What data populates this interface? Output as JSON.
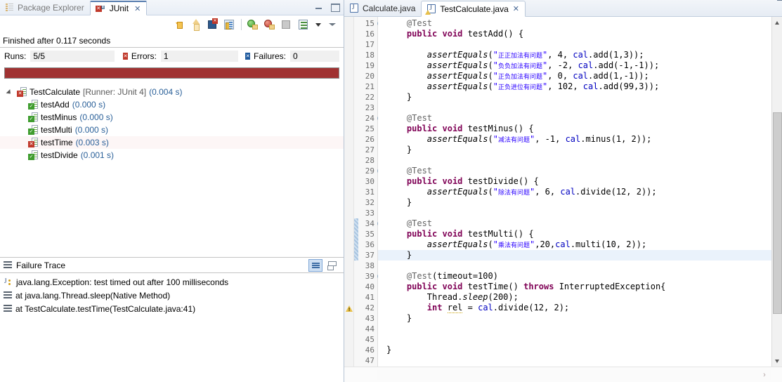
{
  "junit_view": {
    "tabs": [
      {
        "label": "Package Explorer",
        "icon": "package-explorer-icon",
        "active": false
      },
      {
        "label": "JUnit",
        "icon": "junit-icon",
        "active": true,
        "close": "✕"
      }
    ],
    "window_controls": {
      "minimize": "minimize-icon",
      "maximize": "maximize-icon"
    },
    "toolbar": [
      {
        "name": "next-failed-test-button",
        "icon": "arrow-down-icon",
        "tooltip": "Next Failed Test"
      },
      {
        "name": "previous-failed-test-button",
        "icon": "arrow-up-icon",
        "tooltip": "Previous Failed Test"
      },
      {
        "name": "show-failures-only-button",
        "icon": "failures-only-icon",
        "tooltip": "Show Failures Only"
      },
      {
        "name": "scroll-lock-button",
        "icon": "lock-icon",
        "tooltip": "Scroll Lock"
      },
      {
        "name": "rerun-test-button",
        "icon": "rerun-green-icon",
        "tooltip": "Rerun Test"
      },
      {
        "name": "rerun-failed-button",
        "icon": "rerun-failed-icon",
        "tooltip": "Rerun Test - Failures First"
      },
      {
        "name": "stop-button",
        "icon": "stop-icon",
        "tooltip": "Stop JUnit Test Run"
      },
      {
        "name": "test-run-history-button",
        "icon": "history-list-icon",
        "tooltip": "Test Run History"
      },
      {
        "name": "view-menu-button",
        "icon": "chevron-down-icon",
        "tooltip": "View Menu"
      },
      {
        "name": "minimize-view-button",
        "icon": "collapse-chevron-icon",
        "tooltip": "Minimize"
      }
    ],
    "status_text": "Finished after 0.117 seconds",
    "counters": {
      "runs_label": "Runs:",
      "runs_value": "5/5",
      "errors_label": "Errors:",
      "errors_value": "1",
      "failures_label": "Failures:",
      "failures_value": "0"
    },
    "progress": {
      "percent": 100,
      "color": "#a03232",
      "state": "failure"
    },
    "tree": {
      "root": {
        "name": "TestCalculate",
        "runner": "[Runner: JUnit 4]",
        "time": "(0.004 s)",
        "status": "error",
        "expanded": true
      },
      "children": [
        {
          "name": "testAdd",
          "time": "(0.000 s)",
          "status": "pass"
        },
        {
          "name": "testMinus",
          "time": "(0.000 s)",
          "status": "pass"
        },
        {
          "name": "testMulti",
          "time": "(0.000 s)",
          "status": "pass"
        },
        {
          "name": "testTime",
          "time": "(0.003 s)",
          "status": "error",
          "selected": true
        },
        {
          "name": "testDivide",
          "time": "(0.001 s)",
          "status": "pass"
        }
      ]
    },
    "failure_trace": {
      "title": "Failure Trace",
      "tools": [
        {
          "name": "filter-stack-trace-button",
          "icon": "filter-icon",
          "pressed": true
        },
        {
          "name": "compare-result-button",
          "icon": "compare-icon",
          "pressed": false
        }
      ],
      "rows": [
        {
          "icon": "exception-icon",
          "text": "java.lang.Exception: test timed out after 100 milliseconds"
        },
        {
          "icon": "stack-frame-icon",
          "text": "at java.lang.Thread.sleep(Native Method)"
        },
        {
          "icon": "stack-frame-icon",
          "text": "at TestCalculate.testTime(TestCalculate.java:41)"
        }
      ]
    }
  },
  "editor": {
    "tabs": [
      {
        "label": "Calculate.java",
        "icon": "java-file-icon",
        "active": false,
        "warning": false
      },
      {
        "label": "TestCalculate.java",
        "icon": "java-file-icon",
        "active": true,
        "warning": true,
        "close": "✕"
      }
    ],
    "window_controls": {
      "minimize": "minimize-icon"
    },
    "first_line": 15,
    "lines": [
      {
        "n": 15,
        "fold": true,
        "text": "    @Test"
      },
      {
        "n": 16,
        "fold": false,
        "text": "    public void testAdd() {"
      },
      {
        "n": 17,
        "fold": false,
        "text": ""
      },
      {
        "n": 18,
        "fold": false,
        "text": "        assertEquals(\"正正加法有问题\", 4, cal.add(1,3));"
      },
      {
        "n": 19,
        "fold": false,
        "text": "        assertEquals(\"负负加法有问题\", -2, cal.add(-1,-1));"
      },
      {
        "n": 20,
        "fold": false,
        "text": "        assertEquals(\"正负加法有问题\", 0, cal.add(1,-1));"
      },
      {
        "n": 21,
        "fold": false,
        "text": "        assertEquals(\"正负进位有问题\", 102, cal.add(99,3));"
      },
      {
        "n": 22,
        "fold": false,
        "text": "    }"
      },
      {
        "n": 23,
        "fold": false,
        "text": ""
      },
      {
        "n": 24,
        "fold": true,
        "text": "    @Test"
      },
      {
        "n": 25,
        "fold": false,
        "text": "    public void testMinus() {"
      },
      {
        "n": 26,
        "fold": false,
        "text": "        assertEquals(\"减法有问题\", -1, cal.minus(1, 2));"
      },
      {
        "n": 27,
        "fold": false,
        "text": "    }"
      },
      {
        "n": 28,
        "fold": false,
        "text": ""
      },
      {
        "n": 29,
        "fold": true,
        "text": "    @Test"
      },
      {
        "n": 30,
        "fold": false,
        "text": "    public void testDivide() {"
      },
      {
        "n": 31,
        "fold": false,
        "text": "        assertEquals(\"除法有问题\", 6, cal.divide(12, 2));"
      },
      {
        "n": 32,
        "fold": false,
        "text": "    }"
      },
      {
        "n": 33,
        "fold": false,
        "text": ""
      },
      {
        "n": 34,
        "fold": true,
        "text": "    @Test",
        "changed": true
      },
      {
        "n": 35,
        "fold": false,
        "text": "    public void testMulti() {",
        "changed": true
      },
      {
        "n": 36,
        "fold": false,
        "text": "        assertEquals(\"乘法有问题\",20,cal.multi(10, 2));",
        "changed": true
      },
      {
        "n": 37,
        "fold": false,
        "text": "    }",
        "changed": true,
        "highlight": true
      },
      {
        "n": 38,
        "fold": false,
        "text": ""
      },
      {
        "n": 39,
        "fold": true,
        "text": "    @Test(timeout=100)"
      },
      {
        "n": 40,
        "fold": false,
        "text": "    public void testTime() throws InterruptedException{"
      },
      {
        "n": 41,
        "fold": false,
        "text": "        Thread.sleep(200);"
      },
      {
        "n": 42,
        "fold": false,
        "text": "        int rel = cal.divide(12, 2);",
        "warning": true
      },
      {
        "n": 43,
        "fold": false,
        "text": "    }"
      },
      {
        "n": 44,
        "fold": false,
        "text": ""
      },
      {
        "n": 45,
        "fold": false,
        "text": ""
      },
      {
        "n": 46,
        "fold": false,
        "text": "}"
      },
      {
        "n": 47,
        "fold": false,
        "text": ""
      }
    ],
    "scrollbar": {
      "vertical": {
        "thumb_top_pct": 26,
        "thumb_height_pct": 62
      },
      "horizontal": {
        "left_arrow": "‹",
        "right_arrow": "›"
      }
    }
  },
  "colors": {
    "keyword": "#7f0055",
    "string": "#2a00ff",
    "annotation": "#646464",
    "field": "#0000c0",
    "failure_bar": "#a03232",
    "tab_accent": "#5a7fb0",
    "time_text": "#2a6099"
  }
}
